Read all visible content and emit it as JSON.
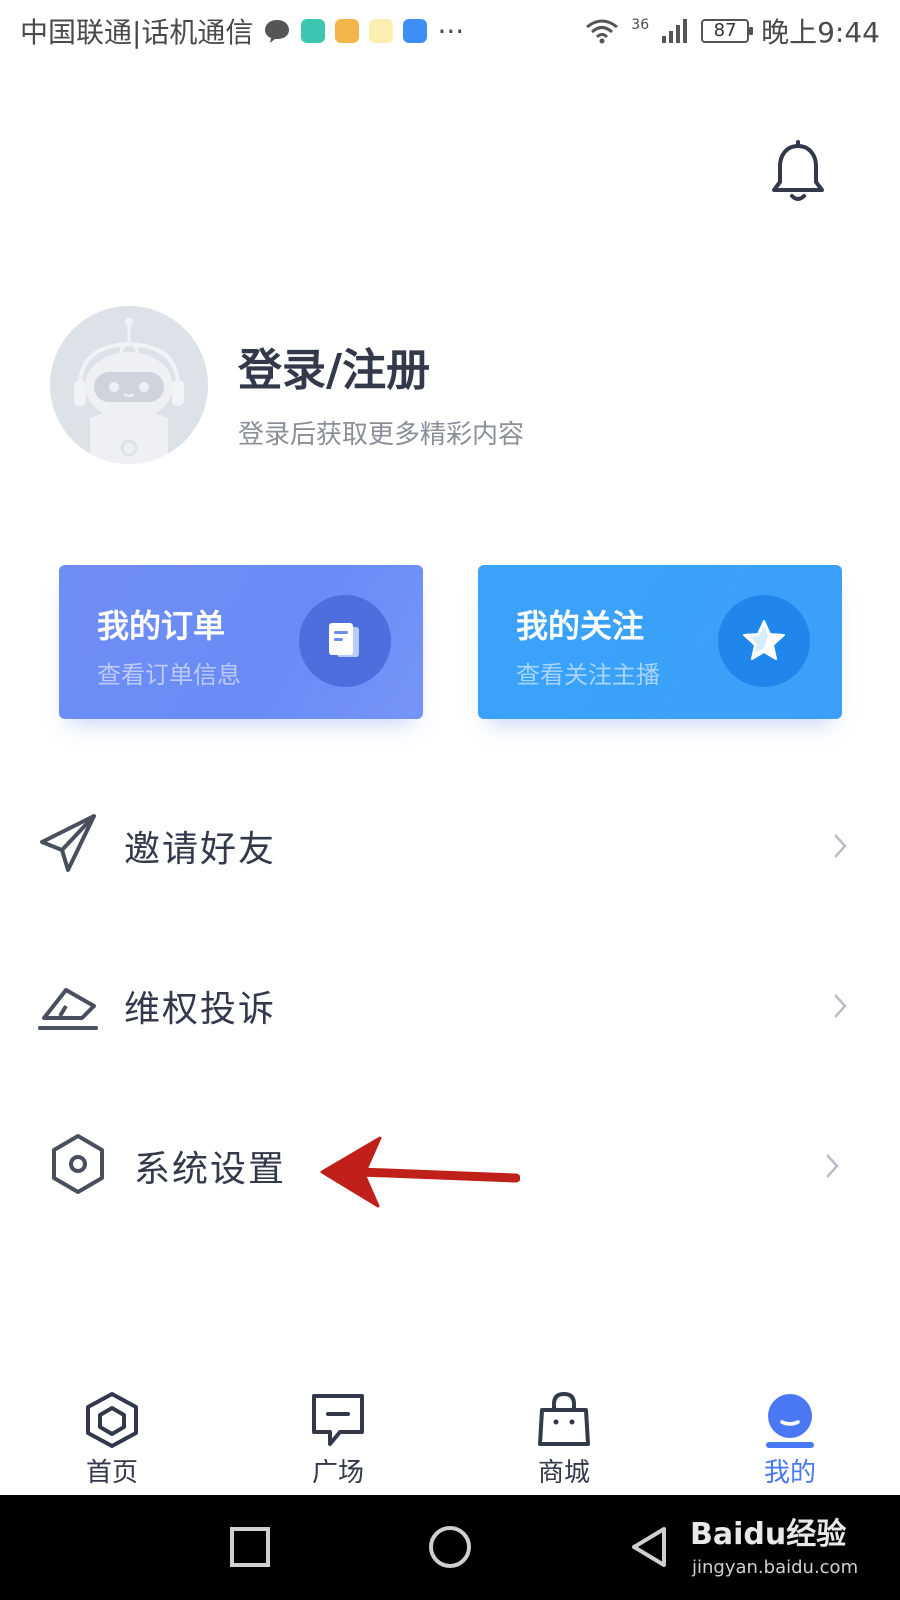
{
  "status_bar": {
    "carrier": "中国联通|话机通信",
    "network": "36",
    "battery": "87",
    "time": "晚上9:44",
    "more": "···"
  },
  "profile": {
    "title": "登录/注册",
    "subtitle": "登录后获取更多精彩内容"
  },
  "cards": [
    {
      "title": "我的订单",
      "subtitle": "查看订单信息",
      "icon": "document-icon",
      "color": "#6f8ef5"
    },
    {
      "title": "我的关注",
      "subtitle": "查看关注主播",
      "icon": "star-icon",
      "color": "#3aa3fb"
    }
  ],
  "menu": [
    {
      "label": "邀请好友",
      "icon": "paper-plane-icon"
    },
    {
      "label": "维权投诉",
      "icon": "eraser-icon"
    },
    {
      "label": "系统设置",
      "icon": "hexagon-settings-icon"
    }
  ],
  "tabs": [
    {
      "label": "首页",
      "icon": "home-hexagon-icon"
    },
    {
      "label": "广场",
      "icon": "message-square-icon"
    },
    {
      "label": "商城",
      "icon": "shopping-bag-icon"
    },
    {
      "label": "我的",
      "icon": "profile-icon",
      "active": true
    }
  ],
  "watermark": {
    "brand": "Baidu经验",
    "url": "jingyan.baidu.com"
  },
  "colors": {
    "accent": "#4a78f5",
    "text_dark": "#33384a",
    "annotation_arrow": "#c0201a"
  }
}
